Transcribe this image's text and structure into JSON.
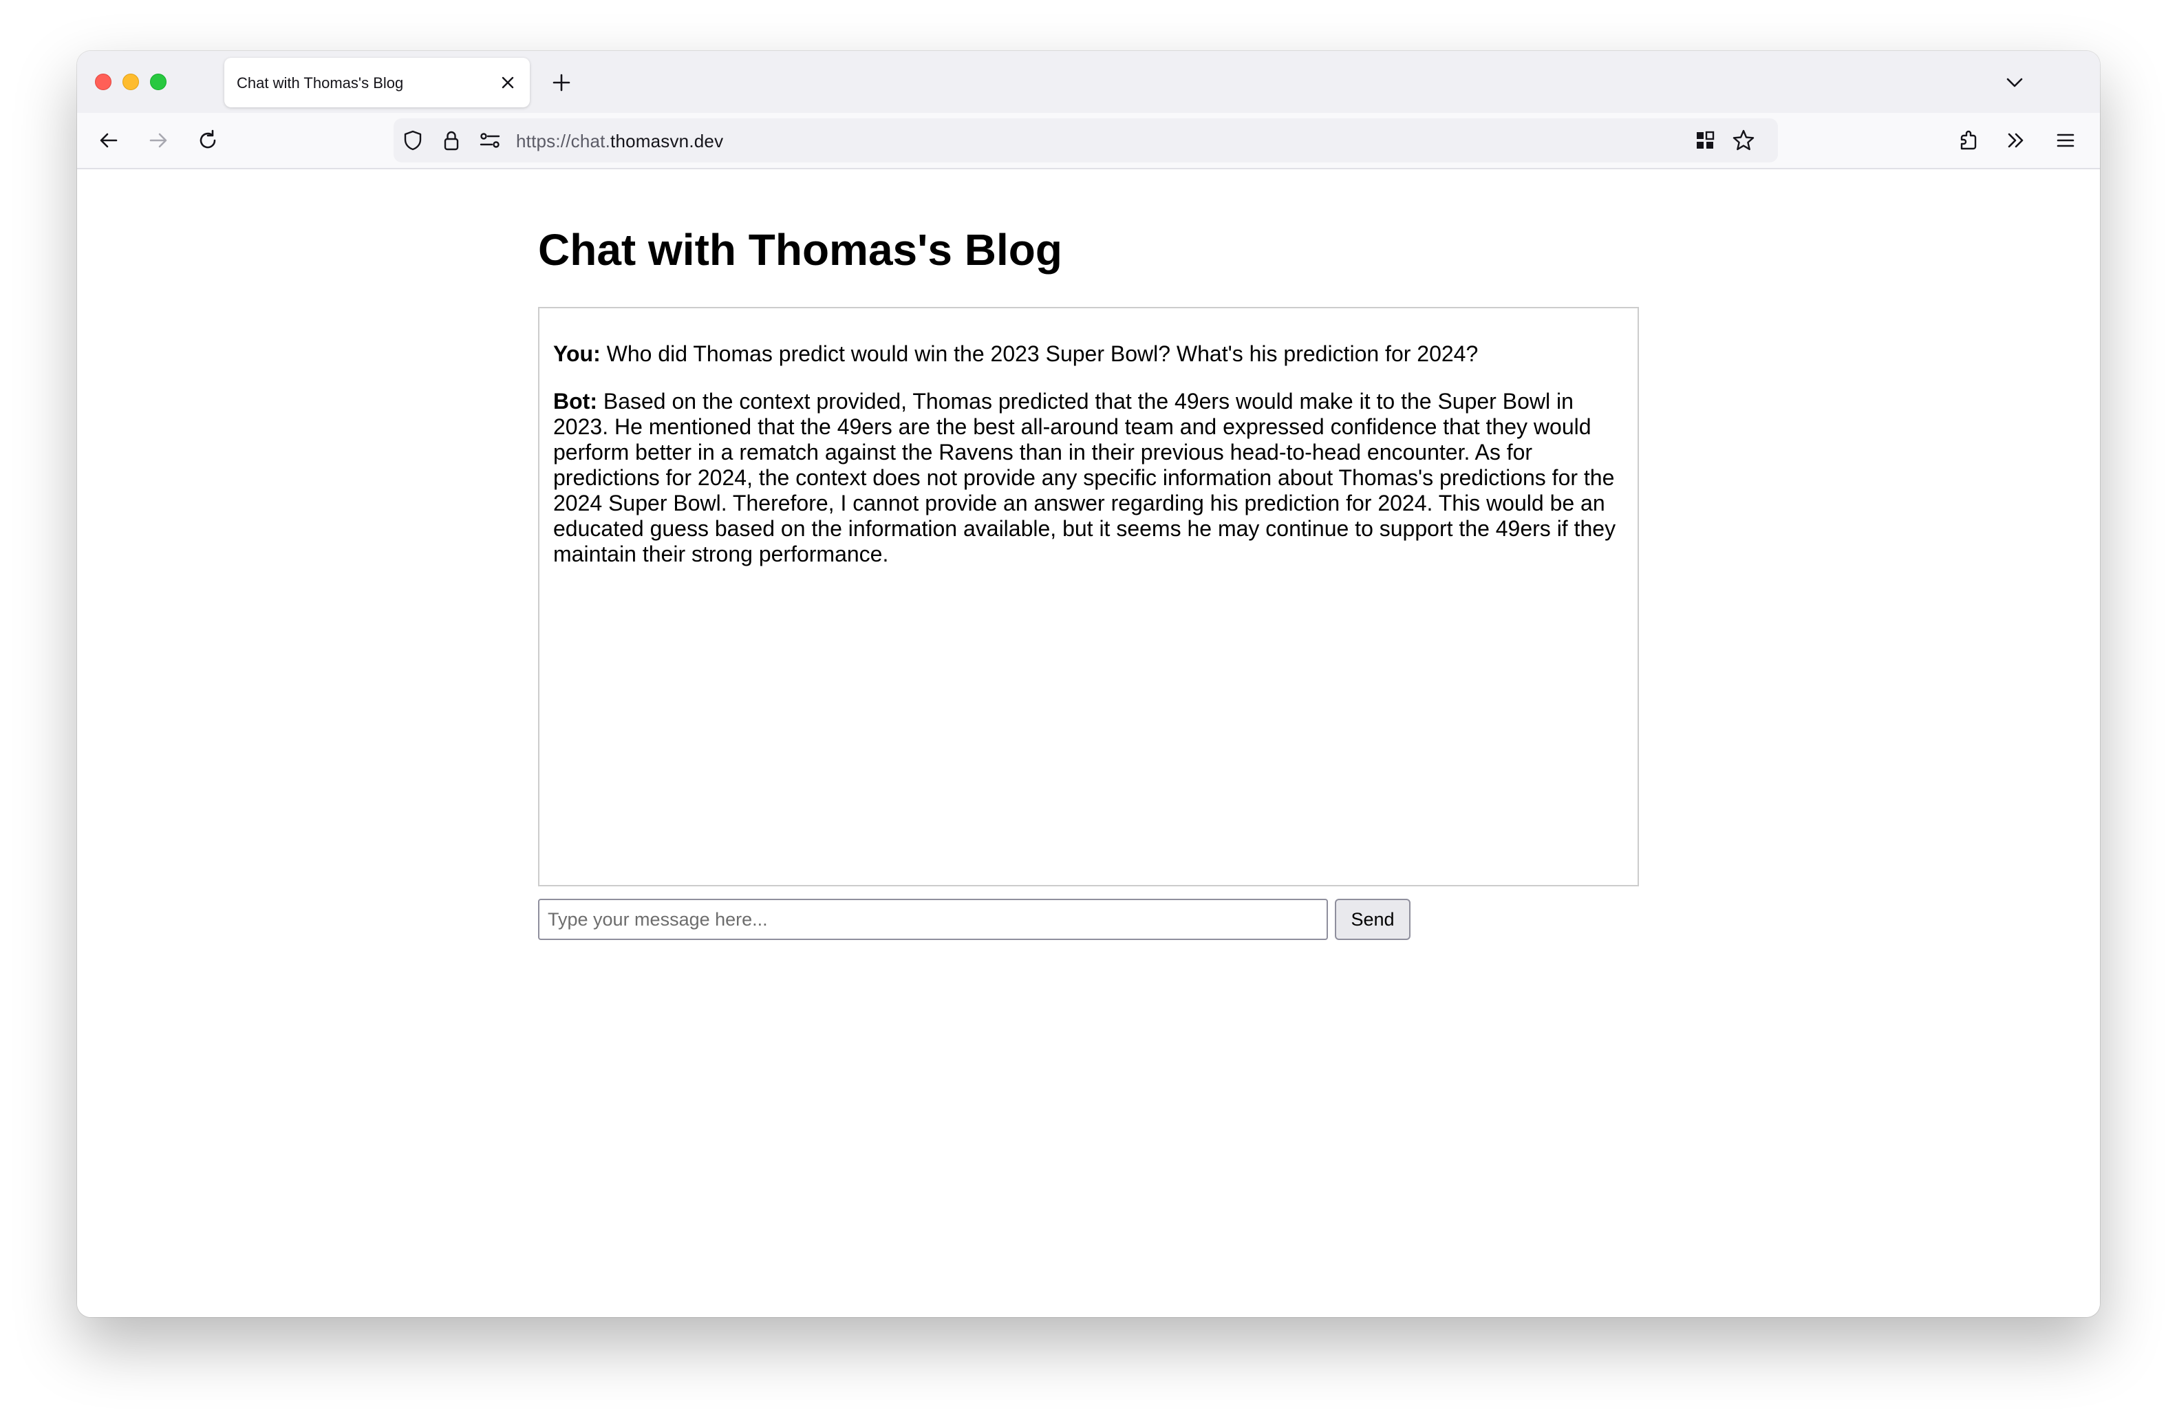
{
  "browser": {
    "tab_title": "Chat with Thomas's Blog",
    "url_scheme": "https://chat.",
    "url_host": "thomasvn.dev",
    "icons": [
      "close-icon",
      "plus-icon",
      "chevron-down-icon",
      "back-arrow-icon",
      "forward-arrow-icon",
      "reload-icon",
      "shield-icon",
      "lock-icon",
      "permissions-icon",
      "qr-code-icon",
      "star-icon",
      "extensions-icon",
      "overflow-chevrons-icon",
      "hamburger-menu-icon"
    ]
  },
  "page": {
    "title": "Chat with Thomas's Blog"
  },
  "chat": {
    "messages": [
      {
        "sender": "You:",
        "text": "Who did Thomas predict would win the 2023 Super Bowl? What's his prediction for 2024?"
      },
      {
        "sender": "Bot:",
        "text": "Based on the context provided, Thomas predicted that the 49ers would make it to the Super Bowl in 2023. He mentioned that the 49ers are the best all-around team and expressed confidence that they would perform better in a rematch against the Ravens than in their previous head-to-head encounter. As for predictions for 2024, the context does not provide any specific information about Thomas's predictions for the 2024 Super Bowl. Therefore, I cannot provide an answer regarding his prediction for 2024. This would be an educated guess based on the information available, but it seems he may continue to support the 49ers if they maintain their strong performance."
      }
    ],
    "input_placeholder": "Type your message here...",
    "input_value": "",
    "send_label": "Send"
  }
}
